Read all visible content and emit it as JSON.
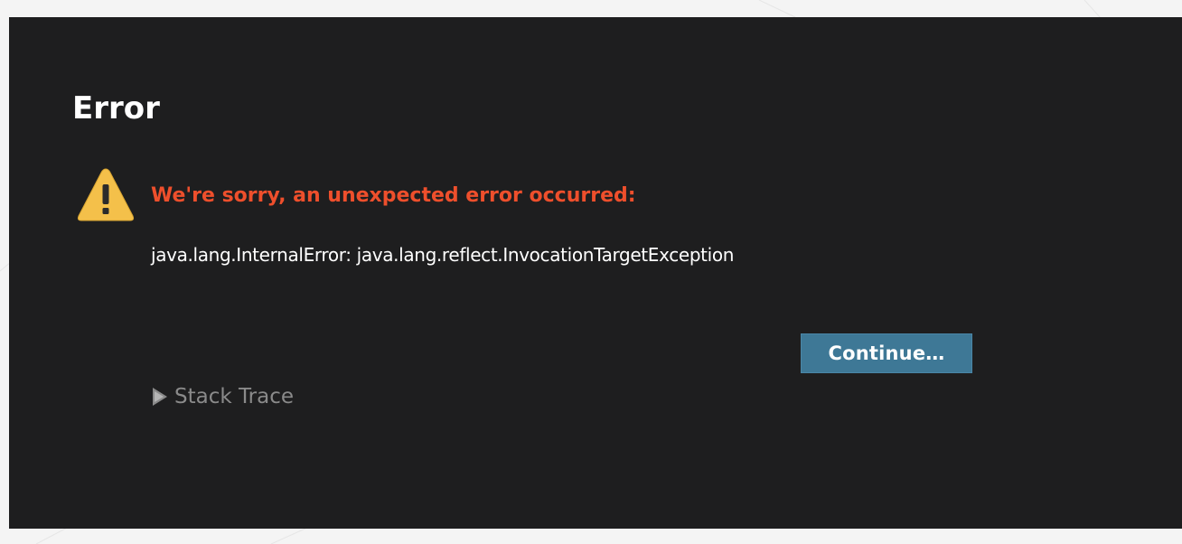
{
  "dialog": {
    "title": "Error",
    "icon": "warning-icon",
    "heading": "We're sorry, an unexpected error occurred:",
    "message": "java.lang.InternalError: java.lang.reflect.InvocationTargetException",
    "continue_label": "Continue…",
    "stack_trace_label": "Stack Trace",
    "stack_trace_icon": "disclosure-triangle-icon",
    "stack_trace_expanded": false
  },
  "colors": {
    "dialog_background": "#1e1e1f",
    "page_background": "#f4f4f4",
    "heading": "#ee4f2c",
    "button": "#3e7896",
    "warning_fill": "#f4c04a",
    "muted_text": "#8a8a8a"
  }
}
